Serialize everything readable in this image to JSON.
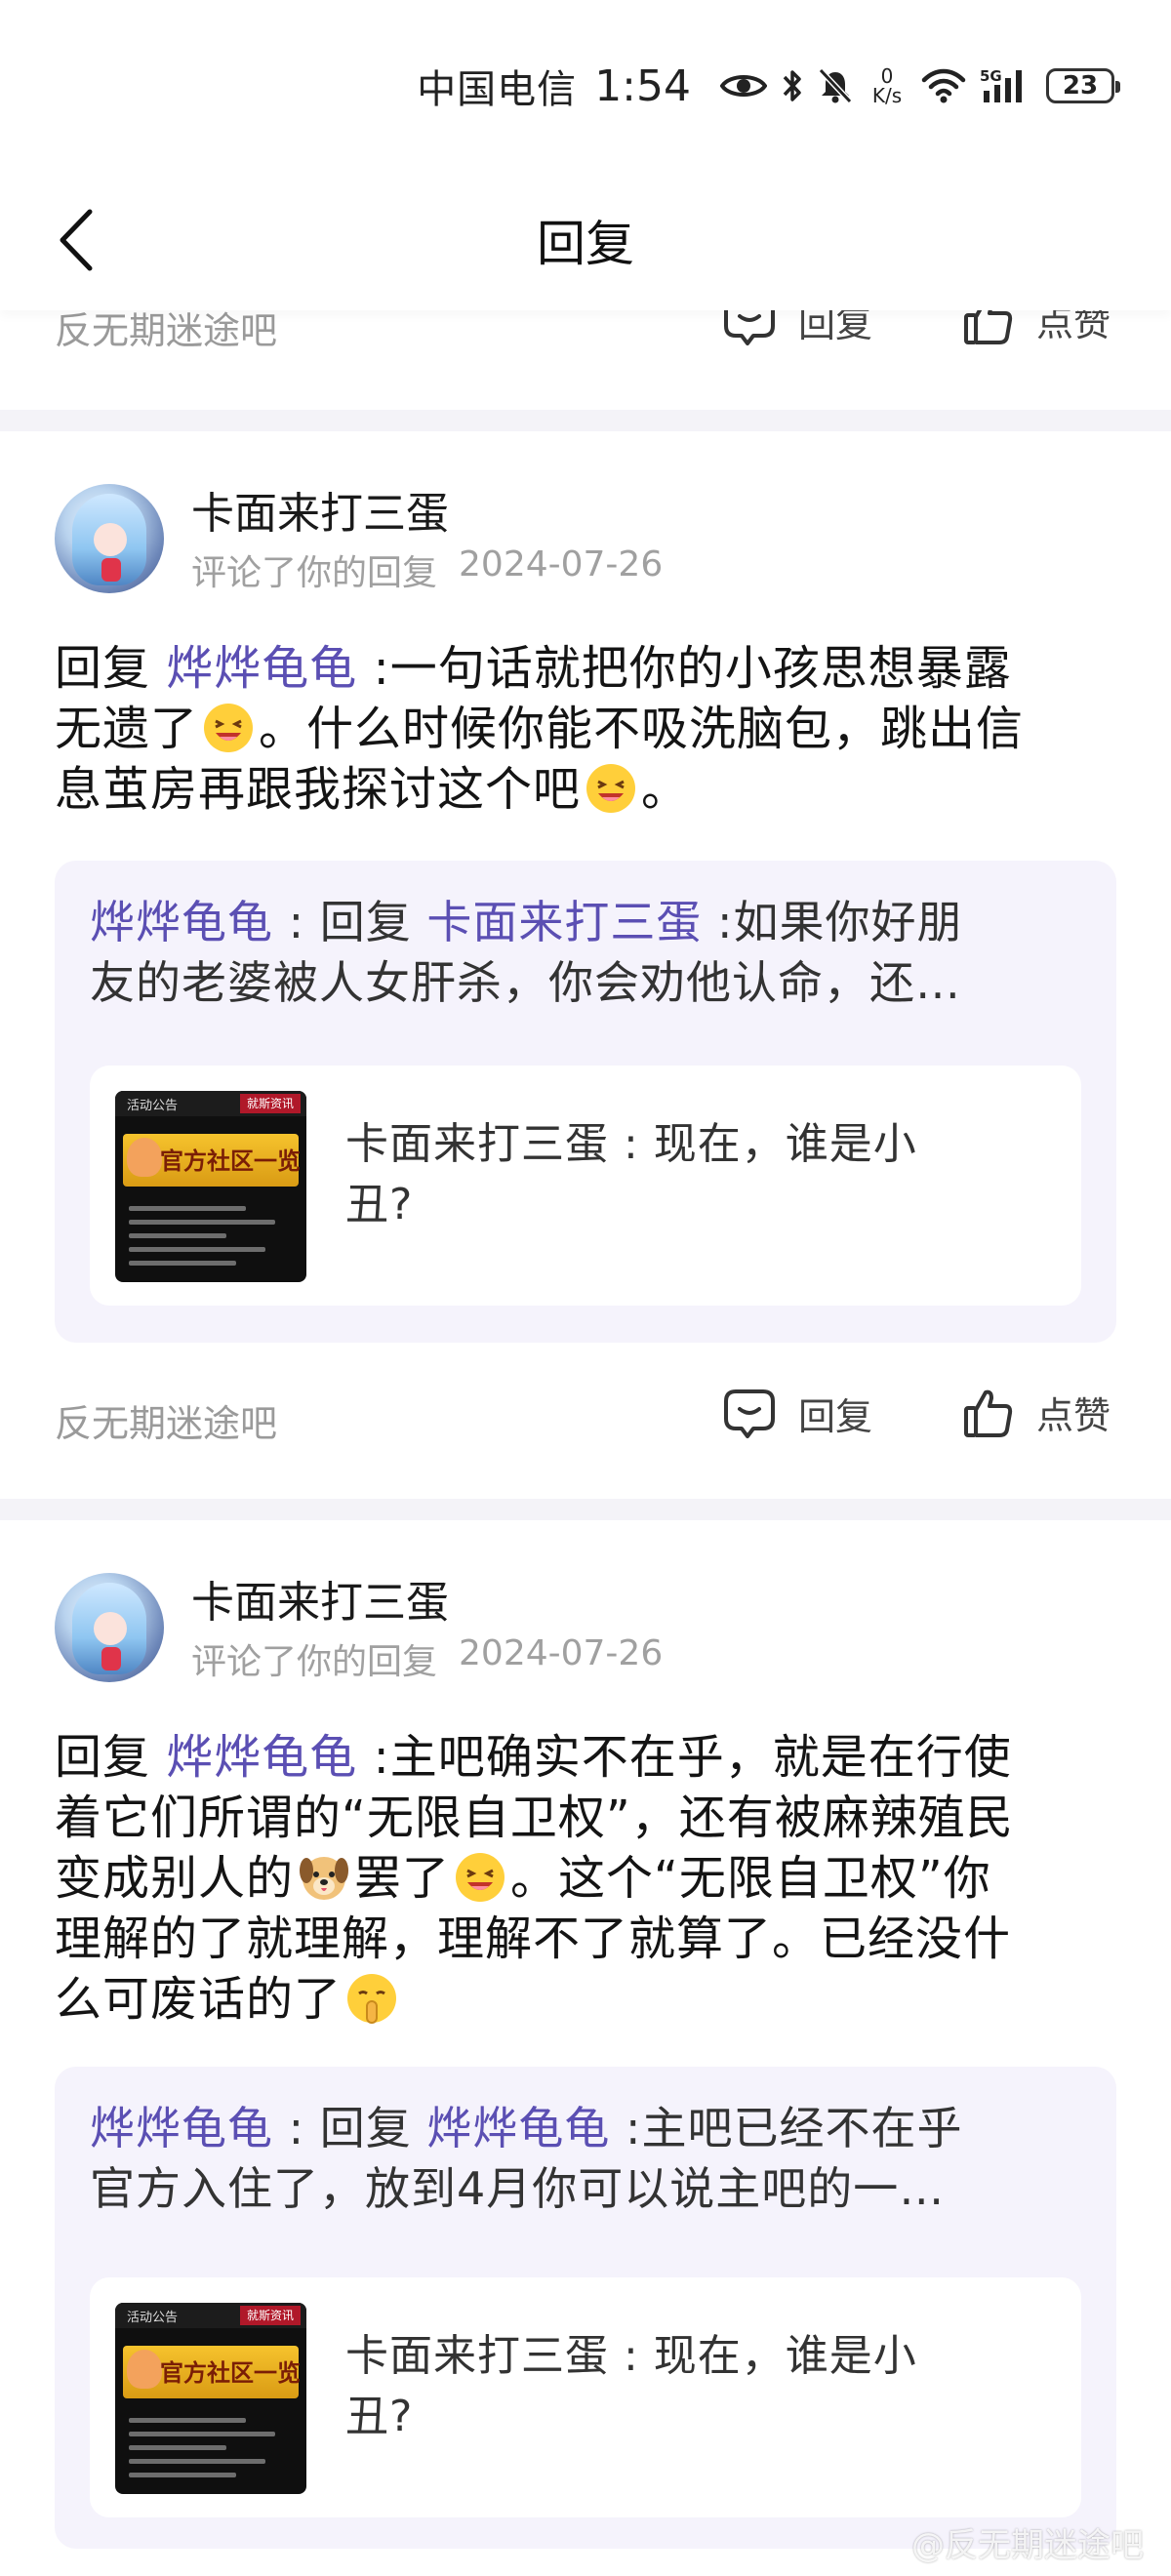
{
  "status_bar": {
    "carrier": "中国电信",
    "time": "1:54",
    "net_speed_value": "0",
    "net_speed_unit": "K/s",
    "signal_type": "5G",
    "battery": "23"
  },
  "header": {
    "title": "回复"
  },
  "partial_card": {
    "forum": "反无期迷途吧",
    "reply_label": "回复",
    "like_label": "点赞"
  },
  "posts": [
    {
      "username": "卡面来打三蛋",
      "action": "评论了你的回复",
      "date": "2024-07-26",
      "body": {
        "prefix": "回复",
        "mention": "烨烨龟龟",
        "line1_rest": ":一句话就把你的小孩思想暴露",
        "line2_a": "无遗了",
        "line2_b": "。什么时候你能不吸洗脑包，跳出信",
        "line3_a": "息茧房再跟我探讨这个吧",
        "line3_b": "。"
      },
      "quote": {
        "author": "烨烨龟龟",
        "sep": " : 回复 ",
        "target": "卡面来打三蛋",
        "line1_rest": ":如果你好朋",
        "line2": "友的老婆被人女肝杀，你会劝他认命，还…"
      },
      "inner": {
        "thumb_tag_left": "活动公告",
        "thumb_tag_right": "就斯资讯",
        "thumb_banner": "官方社区一览",
        "author": "卡面来打三蛋",
        "line1_rest": " : 现在，谁是小",
        "line2": "丑?"
      },
      "footer": {
        "forum": "反无期迷途吧",
        "reply_label": "回复",
        "like_label": "点赞"
      }
    },
    {
      "username": "卡面来打三蛋",
      "action": "评论了你的回复",
      "date": "2024-07-26",
      "body": {
        "prefix": "回复",
        "mention": "烨烨龟龟",
        "line1_rest": ":主吧确实不在乎，就是在行使",
        "line2": "着它们所谓的“无限自卫权”，还有被麻辣殖民",
        "line3_a": "变成别人的",
        "line3_b": "罢了",
        "line3_c": "。这个“无限自卫权”你",
        "line4": "理解的了就理解，理解不了就算了。已经没什",
        "line5": "么可废话的了"
      },
      "quote": {
        "author": "烨烨龟龟",
        "sep": " : 回复 ",
        "target": "烨烨龟龟",
        "line1_rest": ":主吧已经不在乎",
        "line2": "官方入住了，放到4月你可以说主吧的一…"
      },
      "inner": {
        "thumb_tag_left": "活动公告",
        "thumb_tag_right": "就斯资讯",
        "thumb_banner": "官方社区一览",
        "author": "卡面来打三蛋",
        "line1_rest": " : 现在，谁是小",
        "line2": "丑?"
      }
    }
  ],
  "watermark": "@反无期迷途吧",
  "colors": {
    "mention": "#5b4fb3",
    "quote_bg": "#f5f3fc",
    "divider": "#f4f3f8"
  }
}
